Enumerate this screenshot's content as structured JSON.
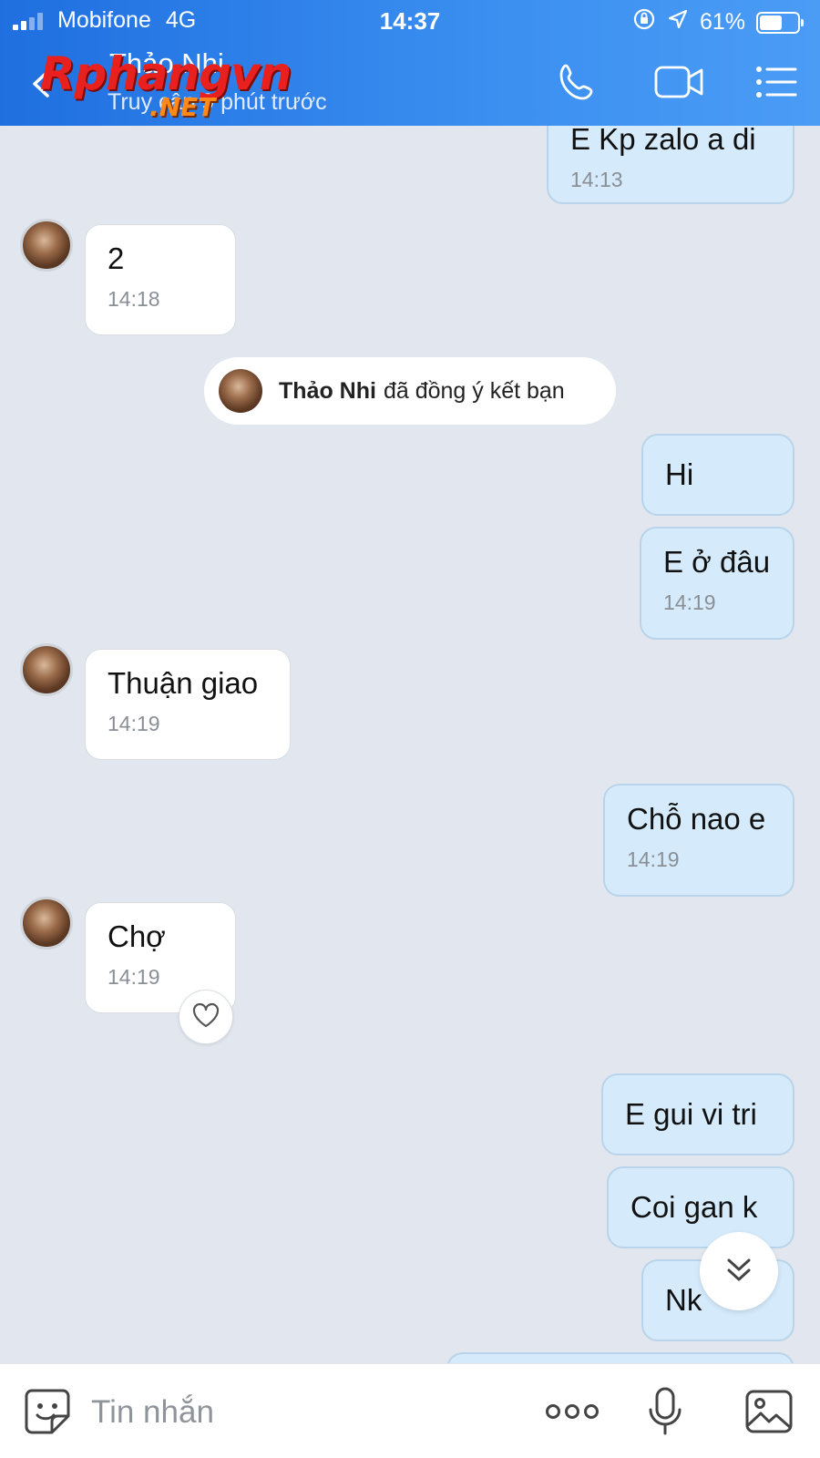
{
  "status_bar": {
    "carrier": "Mobifone",
    "network": "4G",
    "time": "14:37",
    "battery": "61%",
    "battery_level": 0.61
  },
  "header": {
    "title": "Thảo Nhi",
    "subtitle": "Truy cập 9 phút trước",
    "watermark_main": "Rphangvn",
    "watermark_sub": ".NET",
    "icons": [
      "back-icon",
      "phone-icon",
      "video-call-icon",
      "menu-list-icon"
    ]
  },
  "messages": [
    {
      "side": "out",
      "text": "E Kp zalo a di",
      "time": "14:13"
    },
    {
      "side": "in",
      "text": "2",
      "time": "14:18"
    },
    {
      "side": "out",
      "text": "Hi",
      "time": ""
    },
    {
      "side": "out",
      "text": "E ở đâu",
      "time": "14:19"
    },
    {
      "side": "in",
      "text": "Thuận giao",
      "time": "14:19"
    },
    {
      "side": "out",
      "text": "Chỗ nao e",
      "time": "14:19"
    },
    {
      "side": "in",
      "text": "Chợ",
      "time": "14:19"
    },
    {
      "side": "out",
      "text": "E gui vi tri",
      "time": ""
    },
    {
      "side": "out",
      "text": "Coi gan k",
      "time": ""
    },
    {
      "side": "out",
      "text": "Nk",
      "time": ""
    }
  ],
  "system_notice": {
    "name": "Thảo Nhi",
    "text": "đã đồng ý kết bạn"
  },
  "composer": {
    "placeholder": "Tin nhắn",
    "icons": [
      "sticker-icon",
      "more-icon",
      "microphone-icon",
      "image-icon"
    ]
  },
  "colors": {
    "header_start": "#1f6fe0",
    "header_end": "#4a9cf5",
    "chat_background": "#e2e7ef",
    "outgoing_bubble": "#d5ebfb",
    "incoming_bubble": "#ffffff"
  }
}
